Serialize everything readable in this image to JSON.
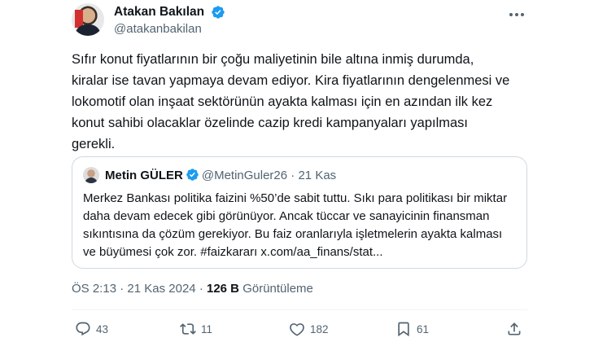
{
  "author": {
    "display_name": "Atakan Bakılan",
    "handle": "@atakanbakilan"
  },
  "tweet_text": "Sıfır konut fiyatlarının bir çoğu maliyetinin bile altına inmiş durumda,\nkiralar ise tavan yapmaya devam ediyor. Kira fiyatlarının dengelenmesi ve\nlokomotif olan inşaat sektörünün ayakta kalması için en azından ilk kez\nkonut sahibi olacaklar özelinde cazip kredi kampanyaları yapılması\ngerekli.",
  "quoted": {
    "display_name": "Metin GÜLER",
    "handle": "@MetinGuler26",
    "separator": "·",
    "date": "21 Kas",
    "text": "Merkez Bankası politika faizini %50’de sabit tuttu. Sıkı para politikası bir miktar\ndaha devam edecek gibi görünüyor. Ancak tüccar ve sanayicinin finansman\nsıkıntısına da çözüm gerekiyor. Bu faiz oranlarıyla işletmelerin ayakta kalması\nve büyümesi çok zor. #faizkararı x.com/aa_finans/stat..."
  },
  "meta": {
    "time": "ÖS 2:13",
    "separator": "·",
    "date": "21 Kas 2024",
    "views_count": "126 B",
    "views_label": "Görüntüleme"
  },
  "actions": {
    "replies": "43",
    "retweets": "11",
    "likes": "182",
    "bookmarks": "61"
  },
  "colors": {
    "verified": "#1d9bf0",
    "secondary_text": "#536471",
    "primary_text": "#0f1419",
    "border": "#cfd9de"
  },
  "icons": [
    "verified-badge-icon",
    "more-icon",
    "reply-icon",
    "retweet-icon",
    "like-icon",
    "bookmark-icon",
    "share-icon"
  ]
}
